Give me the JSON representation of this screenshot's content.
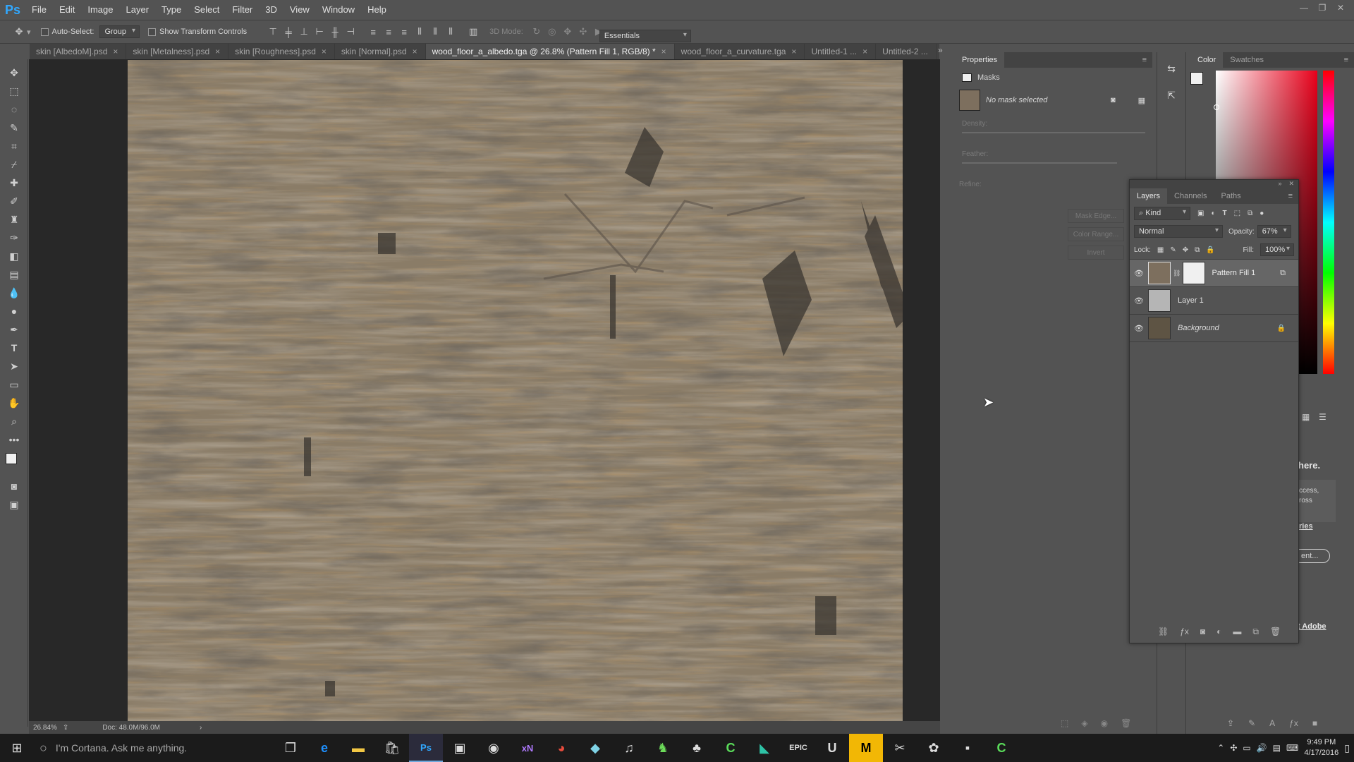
{
  "app": {
    "logo": "Ps",
    "workspace": "Essentials"
  },
  "menu": [
    "File",
    "Edit",
    "Image",
    "Layer",
    "Type",
    "Select",
    "Filter",
    "3D",
    "View",
    "Window",
    "Help"
  ],
  "options": {
    "auto_select_label": "Auto-Select:",
    "auto_select_value": "Group",
    "show_transform_label": "Show Transform Controls",
    "mode_label": "3D Mode:"
  },
  "tabs": [
    {
      "label": "skin [AlbedoM].psd"
    },
    {
      "label": "skin [Metalness].psd"
    },
    {
      "label": "skin [Roughness].psd"
    },
    {
      "label": "skin [Normal].psd"
    },
    {
      "label": "wood_floor_a_albedo.tga @ 26.8% (Pattern Fill 1, RGB/8) *"
    },
    {
      "label": "wood_floor_a_curvature.tga"
    },
    {
      "label": "Untitled-1 ..."
    },
    {
      "label": "Untitled-2 ..."
    }
  ],
  "status": {
    "zoom": "26.84%",
    "doc": "Doc: 48.0M/96.0M"
  },
  "properties": {
    "title": "Properties",
    "section": "Masks",
    "no_mask": "No mask selected",
    "density": "Density:",
    "feather": "Feather:",
    "refine": "Refine:",
    "mask_edge": "Mask Edge...",
    "color_range": "Color Range...",
    "invert": "Invert"
  },
  "color_panel": {
    "tab_color": "Color",
    "tab_swatches": "Swatches"
  },
  "layers_panel": {
    "tabs": [
      "Layers",
      "Channels",
      "Paths"
    ],
    "kind": "Kind",
    "blend_mode": "Normal",
    "opacity_label": "Opacity:",
    "opacity_value": "67%",
    "lock_label": "Lock:",
    "fill_label": "Fill:",
    "fill_value": "100%",
    "layers": [
      {
        "name": "Pattern Fill 1"
      },
      {
        "name": "Layer 1"
      },
      {
        "name": "Background"
      }
    ]
  },
  "libraries": {
    "here": "here.",
    "access": "ccess,",
    "ross": "ross",
    "ries": "ries",
    "ent": "ent...",
    "adobe": "t Adobe"
  },
  "taskbar": {
    "cortana": "I'm Cortana. Ask me anything.",
    "time": "9:49 PM",
    "date": "4/17/2016"
  },
  "colors": {
    "accent": "#31a8ff",
    "panel_bg": "#535353"
  }
}
